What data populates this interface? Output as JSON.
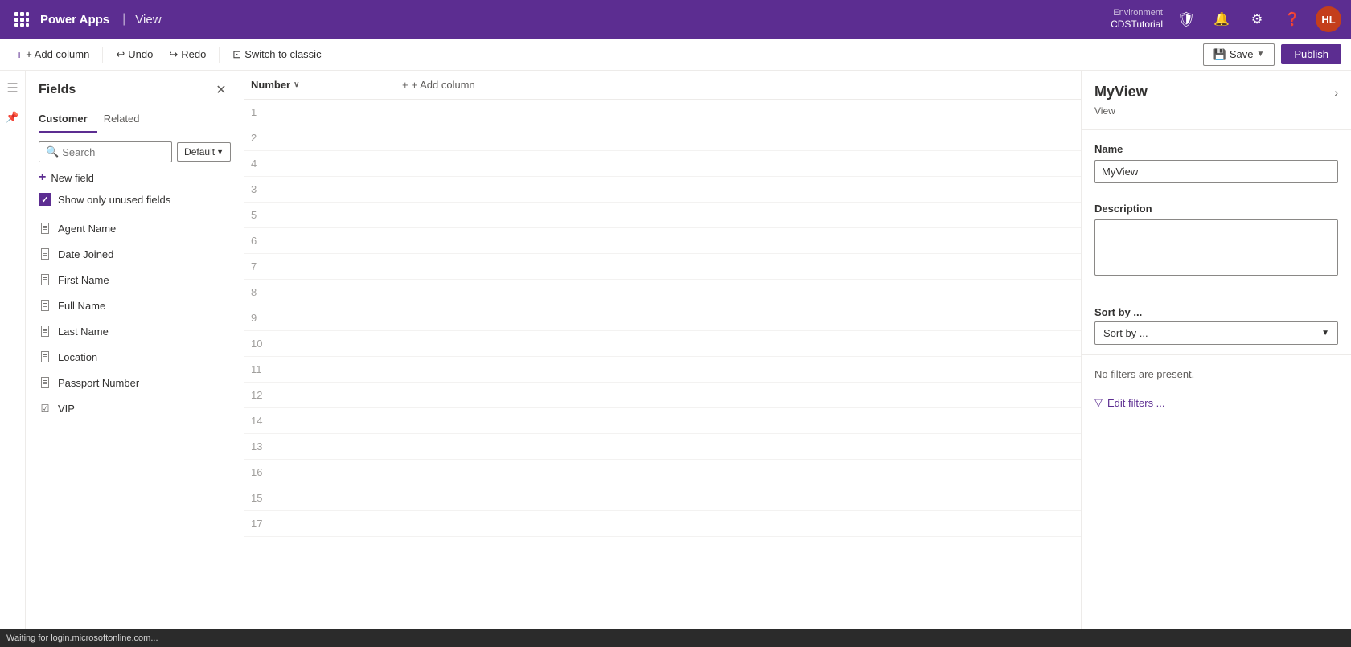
{
  "topNav": {
    "appName": "Power Apps",
    "separator": "|",
    "viewLabel": "View",
    "environment": "Environment",
    "envName": "CDSTutorial",
    "avatar": "HL",
    "avatarColor": "#c43e1c"
  },
  "toolbar": {
    "addColumnLabel": "+ Add column",
    "undoLabel": "Undo",
    "redoLabel": "Redo",
    "switchLabel": "Switch to classic",
    "saveLabel": "Save",
    "publishLabel": "Publish"
  },
  "fieldsPanel": {
    "title": "Fields",
    "tabs": [
      {
        "label": "Customer",
        "active": true
      },
      {
        "label": "Related",
        "active": false
      }
    ],
    "search": {
      "placeholder": "Search",
      "value": ""
    },
    "defaultDropdown": "Default",
    "newFieldLabel": "New field",
    "showUnusedLabel": "Show only unused fields",
    "fields": [
      {
        "name": "Agent Name",
        "iconType": "text"
      },
      {
        "name": "Date Joined",
        "iconType": "text"
      },
      {
        "name": "First Name",
        "iconType": "text"
      },
      {
        "name": "Full Name",
        "iconType": "text"
      },
      {
        "name": "Last Name",
        "iconType": "text"
      },
      {
        "name": "Location",
        "iconType": "text"
      },
      {
        "name": "Passport Number",
        "iconType": "text"
      },
      {
        "name": "VIP",
        "iconType": "check"
      }
    ]
  },
  "grid": {
    "columnHeader": "Number",
    "addColumnLabel": "+ Add column",
    "rows": [
      1,
      2,
      4,
      3,
      5,
      6,
      7,
      8,
      9,
      10,
      11,
      12,
      14,
      13,
      16,
      15,
      17
    ]
  },
  "rightPanel": {
    "title": "MyView",
    "subtitle": "View",
    "chevronLabel": "›",
    "nameLabel": "Name",
    "nameValue": "MyView",
    "descriptionLabel": "Description",
    "descriptionValue": "",
    "sortByLabel": "Sort by ...",
    "sortByDropdownLabel": "Sort by ...",
    "noFiltersText": "No filters are present.",
    "editFiltersLabel": "Edit filters ..."
  },
  "statusBar": {
    "text": "Waiting for login.microsoftonline.com..."
  }
}
